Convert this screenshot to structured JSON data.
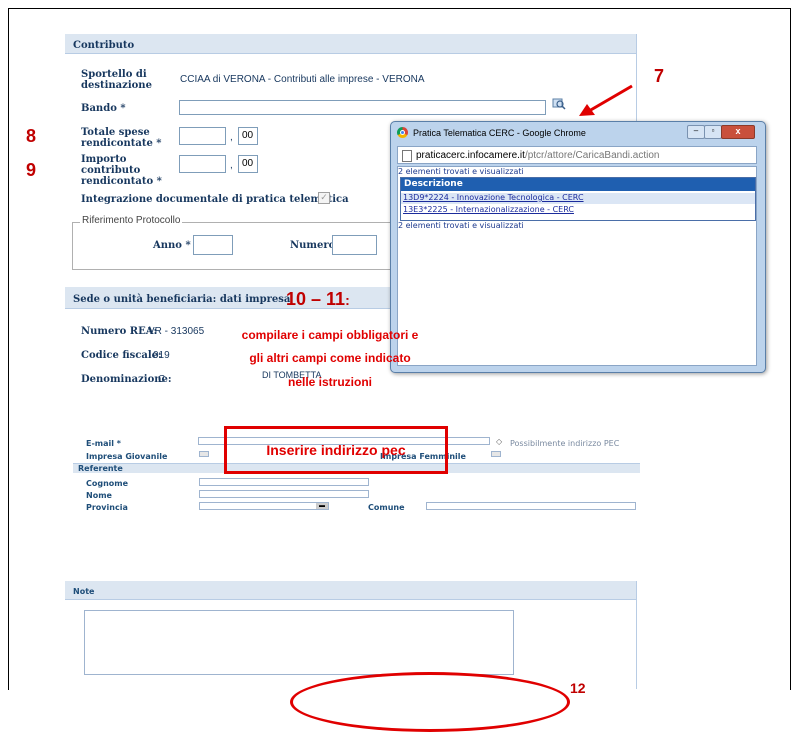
{
  "contributo": {
    "section_title": "Contributo",
    "sportello_label": "Sportello di destinazione",
    "sportello_value": "CCIAA di VERONA - Contributi alle imprese - VERONA",
    "bando_label": "Bando *",
    "totale_label": "Totale spese rendicontate *",
    "totale_decimals": "00",
    "importo_label": "Importo contributo rendicontato *",
    "importo_decimals": "00",
    "integrazione_label": "Integrazione documentale di pratica telematica",
    "riferimento_legend": "Riferimento Protocollo",
    "anno_label": "Anno *",
    "numero_label": "Numero *",
    "comma": ","
  },
  "sede": {
    "section_title": "Sede o unità beneficiaria: dati impresa",
    "rea_label": "Numero REA:",
    "rea_value": "VR - 313065",
    "cf_label": "Codice fiscale:",
    "cf_value": "019",
    "denominazione_label": "Denominazione:",
    "denominazione_value": "C",
    "denominazione_extra": "DI TOMBETTA"
  },
  "popup": {
    "title": "Pratica Telematica CERC - Google Chrome",
    "url_domain": "praticacerc.infocamere.it",
    "url_path": "/ptcr/attore/CaricaBandi.action",
    "found_top": "2 elementi trovati e visualizzati",
    "column_header": "Descrizione",
    "items": [
      "13D9*2224 - Innovazione Tecnologica - CERC",
      "13E3*2225 - Internazionalizzazione - CERC"
    ],
    "found_bottom": "2 elementi trovati e visualizzati"
  },
  "annotations": {
    "n7": "7",
    "n8": "8",
    "n9": "9",
    "n10_11": "10 – 11",
    "n10_11_colon": ":",
    "instructions_line1": "compilare i campi obbligatori e",
    "instructions_line2": "gli altri campi come indicato",
    "instructions_line3": "nelle istruzioni",
    "pec_box": "Inserire indirizzo pec",
    "n_bottom": "12"
  },
  "lower_form": {
    "email_label": "E-mail *",
    "email_hint": "Possibilmente indirizzo PEC",
    "impresa_giovanile_label": "Impresa Giovanile",
    "impresa_other_label": "Impresa Femminile",
    "referente_title": "Referente",
    "cognome_label": "Cognome",
    "nome_label": "Nome",
    "provincia_label": "Provincia",
    "comune_label": "Comune"
  },
  "note": {
    "section_title": "Note"
  },
  "colors": {
    "annotation_red": "#e00000",
    "section_bg": "#dce6f1",
    "label_blue": "#17375e",
    "popup_header": "#1f5fb0"
  }
}
